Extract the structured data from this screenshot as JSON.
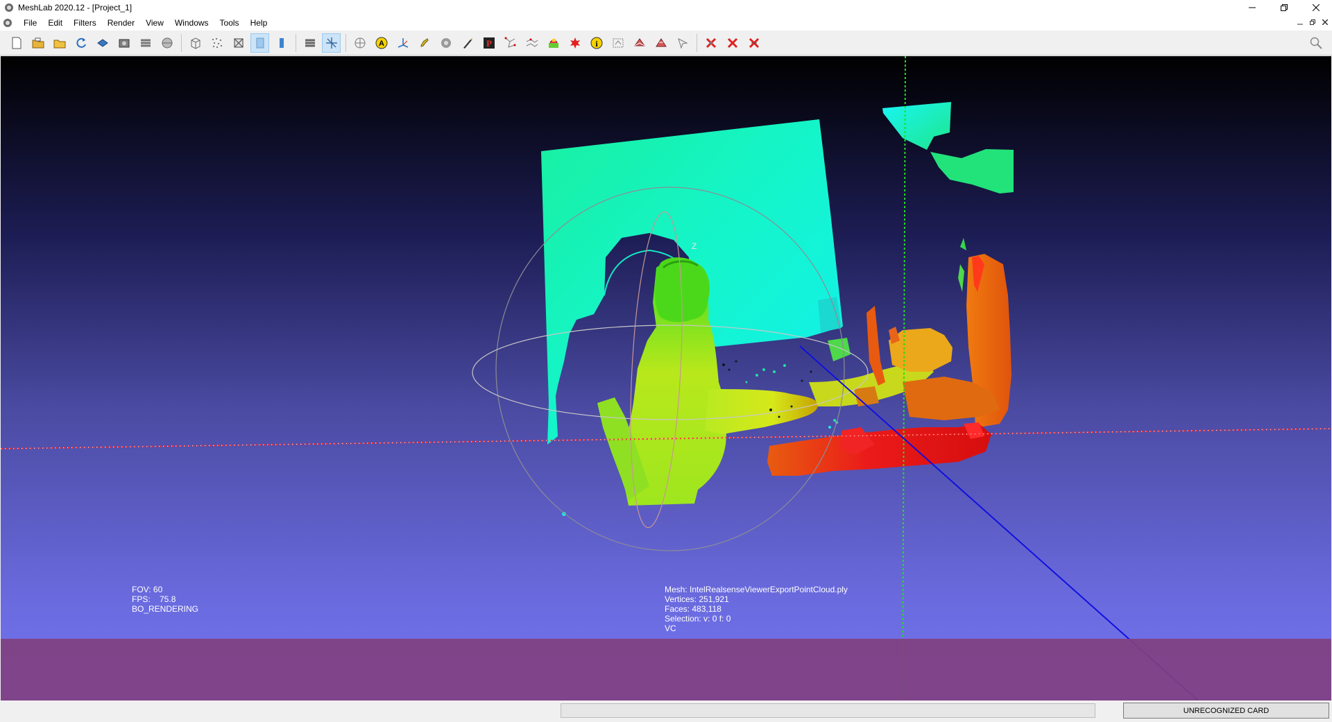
{
  "window": {
    "title": "MeshLab 2020.12 - [Project_1]",
    "app_icon": "meshlab-icon",
    "controls": [
      "minimize-icon",
      "restore-icon",
      "close-icon"
    ]
  },
  "menu": {
    "items": [
      "File",
      "Edit",
      "Filters",
      "Render",
      "View",
      "Windows",
      "Tools",
      "Help"
    ]
  },
  "toolbar": {
    "buttons": [
      "new-project-icon",
      "open-project-icon",
      "import-mesh-icon",
      "reload-icon",
      "export-mesh-icon",
      "snapshot-icon",
      "layer-dialog-icon",
      "bbox-icon",
      "wireframe-icon",
      "points-icon",
      "flat-icon",
      "smooth-icon",
      "texture-icon",
      "flat-lines-icon",
      "light-icon",
      "selection-icon",
      "manipulator-icon",
      "annotation-icon",
      "measure-icon",
      "paint-icon",
      "select-icon",
      "align-icon",
      "pick-points-icon",
      "reference-icon",
      "color-paint-icon",
      "georef-icon",
      "info-icon",
      "raster-icon",
      "delete-vertices-icon",
      "delete-faces-icon",
      "select-none-icon",
      "cut-icon",
      "delete-selected-icon",
      "delete-faces-selected-icon",
      "delete-all-selected-icon"
    ],
    "search_icon": "search-icon"
  },
  "viewport": {
    "axis_label": "Z",
    "info_left": {
      "fov": "FOV: 60",
      "fps": "FPS:    75.8",
      "rendering": "BO_RENDERING"
    },
    "info_right": {
      "mesh": "Mesh: IntelRealsenseViewerExportPointCloud.ply",
      "vertices": "Vertices: 251,921",
      "faces": "Faces: 483,118",
      "selection": "Selection: v: 0 f: 0",
      "vc": "VC"
    }
  },
  "statusbar": {
    "card_label": "UNRECOGNIZED CARD"
  }
}
